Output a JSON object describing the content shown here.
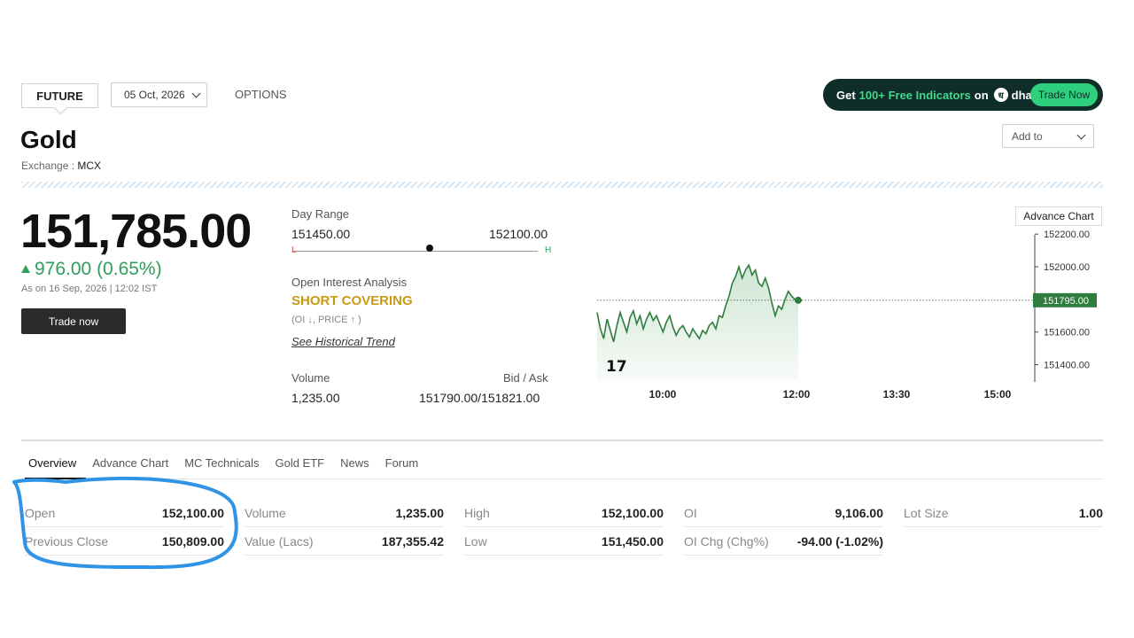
{
  "tabs": {
    "future": "FUTURE",
    "expiry": "05 Oct, 2026",
    "options": "OPTIONS"
  },
  "banner": {
    "prefix": "Get",
    "highlight": "100+ Free Indicators",
    "on": "on",
    "brand": "dhan",
    "button": "Trade Now"
  },
  "instrument": {
    "name": "Gold",
    "exchange_label": "Exchange :",
    "exchange": "MCX"
  },
  "add_to": "Add to",
  "quote": {
    "price": "151,785.00",
    "change": "976.00 (0.65%)",
    "as_on": "As on 16 Sep, 2026 | 12:02 IST",
    "trade_now": "Trade now"
  },
  "day_range": {
    "label": "Day Range",
    "low": "151450.00",
    "high": "152100.00",
    "l": "L",
    "h": "H",
    "position_fraction": 0.56
  },
  "oi_analysis": {
    "label": "Open Interest Analysis",
    "status": "SHORT COVERING",
    "sub": "(OI ↓, PRICE ↑ )",
    "link": "See Historical Trend"
  },
  "volume": {
    "label": "Volume",
    "value": "1,235.00"
  },
  "bid_ask": {
    "label": "Bid / Ask",
    "value": "151790.00/151821.00"
  },
  "chart_data": {
    "type": "area",
    "button": "Advance Chart",
    "x_ticks": [
      "10:00",
      "12:00",
      "13:30",
      "15:00"
    ],
    "y_ticks": [
      "152200.00",
      "152000.00",
      "151600.00",
      "151400.00"
    ],
    "ylim": [
      151300,
      152250
    ],
    "current_label": "151795.00",
    "current_value": 151795,
    "colors": {
      "line": "#2e7d3e",
      "fill": "#cfe5d3",
      "tag": "#2e7d3e"
    },
    "values": [
      151720,
      151620,
      151560,
      151680,
      151610,
      151540,
      151640,
      151720,
      151660,
      151600,
      151690,
      151730,
      151650,
      151700,
      151620,
      151680,
      151720,
      151670,
      151700,
      151650,
      151600,
      151660,
      151700,
      151630,
      151580,
      151620,
      151640,
      151600,
      151570,
      151620,
      151590,
      151560,
      151610,
      151590,
      151640,
      151660,
      151620,
      151700,
      151690,
      151760,
      151820,
      151900,
      151940,
      152000,
      151930,
      151980,
      152010,
      151950,
      151980,
      151900,
      151880,
      151930,
      151870,
      151780,
      151700,
      151760,
      151740,
      151800,
      151850,
      151820,
      151800,
      151795
    ]
  },
  "nav": [
    "Overview",
    "Advance Chart",
    "MC Technicals",
    "Gold ETF",
    "News",
    "Forum"
  ],
  "stats": [
    [
      {
        "k": "Open",
        "v": "152,100.00"
      },
      {
        "k": "Previous Close",
        "v": "150,809.00"
      }
    ],
    [
      {
        "k": "Volume",
        "v": "1,235.00"
      },
      {
        "k": "Value (Lacs)",
        "v": "187,355.42"
      }
    ],
    [
      {
        "k": "High",
        "v": "152,100.00"
      },
      {
        "k": "Low",
        "v": "151,450.00"
      }
    ],
    [
      {
        "k": "OI",
        "v": "9,106.00"
      },
      {
        "k": "OI Chg (Chg%)",
        "v": "-94.00 (-1.02%)"
      }
    ],
    [
      {
        "k": "Lot Size",
        "v": "1.00"
      }
    ]
  ]
}
